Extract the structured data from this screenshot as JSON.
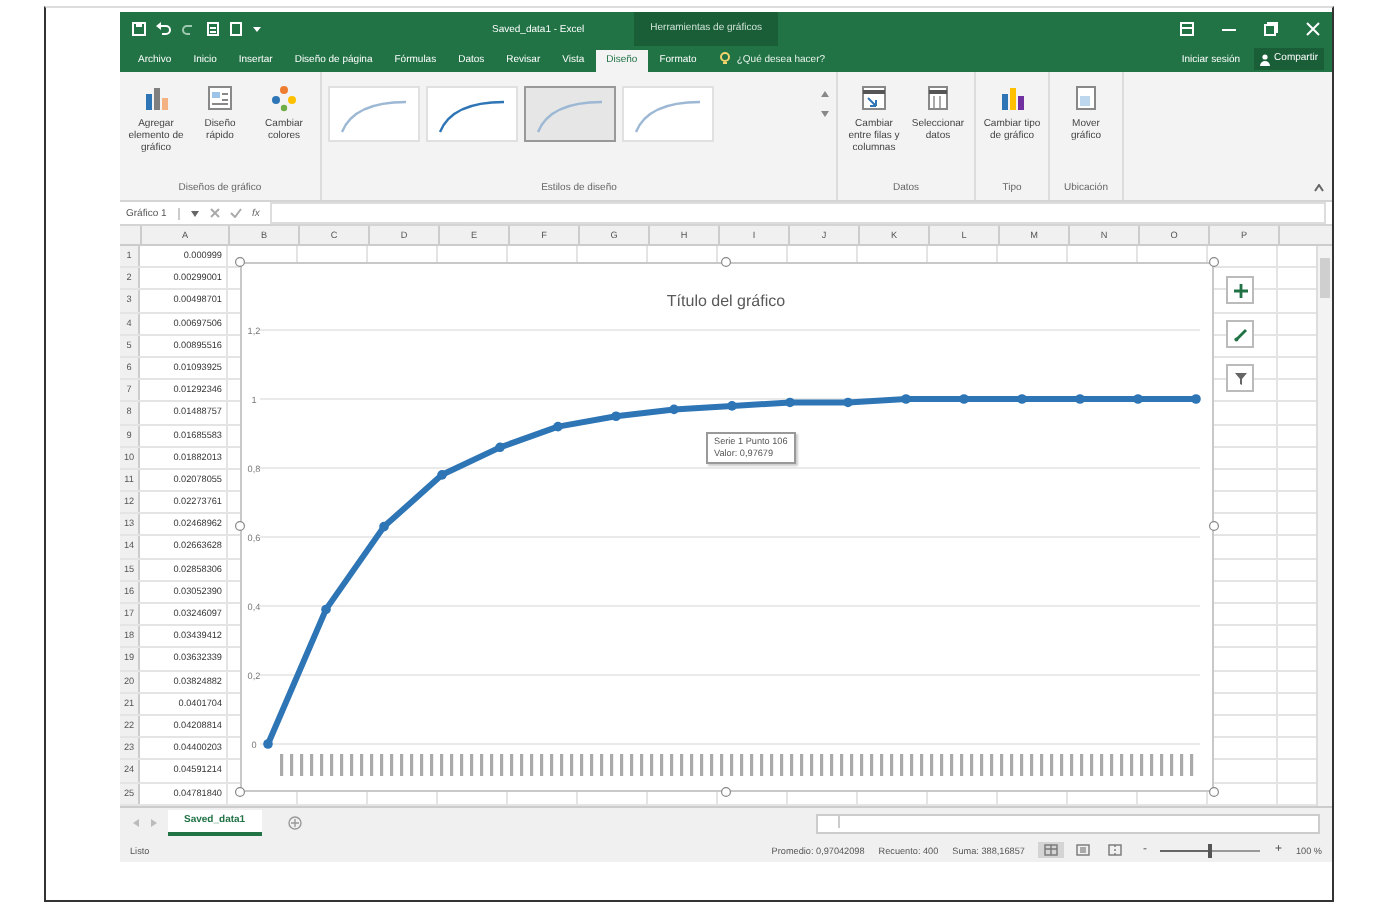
{
  "window": {
    "title": "Saved_data1 - Excel",
    "context_title": "Herramientas de gráficos"
  },
  "tabs": [
    {
      "label": "Archivo",
      "selected": false
    },
    {
      "label": "Inicio",
      "selected": false
    },
    {
      "label": "Insertar",
      "selected": false
    },
    {
      "label": "Diseño de página",
      "selected": false
    },
    {
      "label": "Fórmulas",
      "selected": false
    },
    {
      "label": "Datos",
      "selected": false
    },
    {
      "label": "Revisar",
      "selected": false
    },
    {
      "label": "Vista",
      "selected": false
    },
    {
      "label": "Diseño",
      "selected": true
    },
    {
      "label": "Formato",
      "selected": false
    }
  ],
  "tell_me": "¿Qué desea hacer?",
  "sign_in": "Iniciar sesión",
  "share": "Compartir",
  "ribbon": {
    "layouts_group": {
      "label": "Diseños de gráfico",
      "buttons": [
        {
          "label": "Agregar elemento de gráfico",
          "kind": "add"
        },
        {
          "label": "Diseño rápido",
          "kind": "layout"
        },
        {
          "label": "Cambiar colores",
          "kind": "colors"
        }
      ]
    },
    "styles_group": {
      "label": "Estilos de diseño",
      "styles": [
        {
          "selected": false
        },
        {
          "selected": false
        },
        {
          "selected": true
        },
        {
          "selected": false
        }
      ]
    },
    "groups": [
      {
        "label": "Datos",
        "buttons": [
          {
            "label": "Cambiar entre filas y columnas",
            "kind": "switch"
          },
          {
            "label": "Seleccionar datos",
            "kind": "select"
          }
        ]
      },
      {
        "label": "Tipo",
        "buttons": [
          {
            "label": "Cambiar tipo de gráfico",
            "kind": "type"
          }
        ]
      },
      {
        "label": "Ubicación",
        "buttons": [
          {
            "label": "Mover gráfico",
            "kind": "move"
          }
        ]
      }
    ]
  },
  "formula_bar": {
    "name_box": "Gráfico 1",
    "function_label": "fx"
  },
  "columns": [
    "A",
    "B",
    "C",
    "D",
    "E",
    "F",
    "G",
    "H",
    "I",
    "J",
    "K",
    "L",
    "M",
    "N",
    "O",
    "P"
  ],
  "rows": [
    {
      "number": "1",
      "a": "0.000999"
    },
    {
      "number": "2",
      "a": "0.00299001"
    },
    {
      "number": "3",
      "a": "0.00498701"
    },
    {
      "number": "4",
      "a": "0.00697506"
    },
    {
      "number": "5",
      "a": "0.00895516"
    },
    {
      "number": "6",
      "a": "0.01093925"
    },
    {
      "number": "7",
      "a": "0.01292346"
    },
    {
      "number": "8",
      "a": "0.01488757"
    },
    {
      "number": "9",
      "a": "0.01685583"
    },
    {
      "number": "10",
      "a": "0.01882013"
    },
    {
      "number": "11",
      "a": "0.02078055"
    },
    {
      "number": "12",
      "a": "0.02273761"
    },
    {
      "number": "13",
      "a": "0.02468962"
    },
    {
      "number": "14",
      "a": "0.02663628"
    },
    {
      "number": "15",
      "a": "0.02858306"
    },
    {
      "number": "16",
      "a": "0.03052390"
    },
    {
      "number": "17",
      "a": "0.03246097"
    },
    {
      "number": "18",
      "a": "0.03439412"
    },
    {
      "number": "19",
      "a": "0.03632339"
    },
    {
      "number": "20",
      "a": "0.03824882"
    },
    {
      "number": "21",
      "a": "0.0401704"
    },
    {
      "number": "22",
      "a": "0.04208814"
    },
    {
      "number": "23",
      "a": "0.04400203"
    },
    {
      "number": "24",
      "a": "0.04591214"
    },
    {
      "number": "25",
      "a": "0.04781840"
    }
  ],
  "chart": {
    "tooltip": [
      "Serie 1 Punto 106",
      "Valor: 0,97679"
    ],
    "chart_data": {
      "type": "line",
      "title": "Título del gráfico",
      "grid": true,
      "series": [
        {
          "color": "#2e75b6",
          "marker": true,
          "values": [
            0,
            0.39,
            0.63,
            0.78,
            0.86,
            0.92,
            0.95,
            0.97,
            0.98,
            0.99,
            0.99,
            1,
            1,
            1,
            1,
            1,
            1
          ]
        }
      ],
      "ylim": [
        0,
        1.2
      ],
      "yticks": [
        {
          "value": 0,
          "label": "0"
        },
        {
          "value": 0.2,
          "label": "0,2"
        },
        {
          "value": 0.4,
          "label": "0,4"
        },
        {
          "value": 0.6,
          "label": "0,6"
        },
        {
          "value": 0.8,
          "label": "0,8"
        },
        {
          "value": 1,
          "label": "1"
        },
        {
          "value": 1.2,
          "label": "1,2"
        }
      ]
    }
  },
  "sheet_tabs": [
    {
      "label": "Saved_data1",
      "selected": true
    }
  ],
  "status_bar": {
    "state": "Listo",
    "average": "Promedio: 0,97042098",
    "count": "Recuento: 400",
    "sum": "Suma: 388,16857",
    "views": [
      {
        "selected": true
      },
      {
        "selected": false
      },
      {
        "selected": false
      }
    ],
    "zoom": {
      "minus": "-",
      "plus": "+",
      "level": 0.5,
      "reading": "100 %"
    }
  }
}
